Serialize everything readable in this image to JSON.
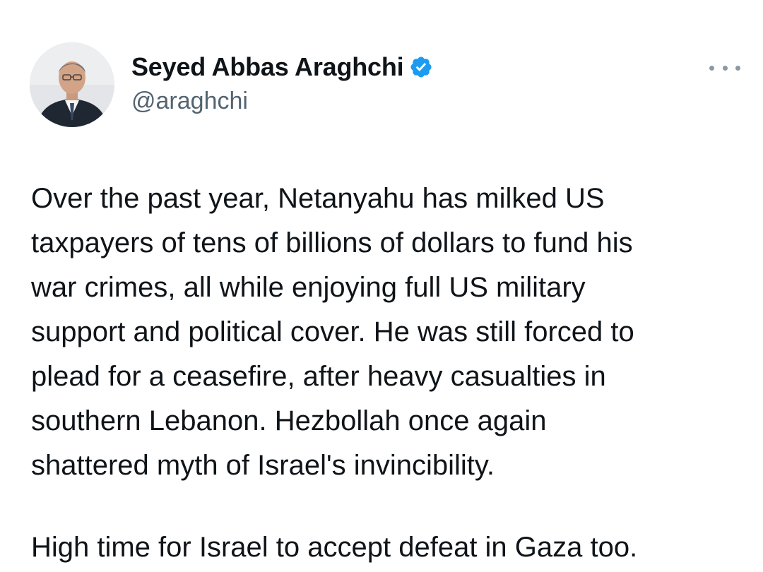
{
  "author": {
    "display_name": "Seyed Abbas Araghchi",
    "handle": "@araghchi",
    "verified": true,
    "verified_color": "#1d9bf0"
  },
  "tweet": {
    "paragraph_1_lines": [
      "Over the past year, Netanyahu has milked US",
      "taxpayers of tens of billions of dollars to fund his",
      "war crimes, all while enjoying full US military",
      "support and political cover. He was still forced to",
      "plead for a ceasefire, after heavy casualties in",
      "southern Lebanon. Hezbollah once again",
      "shattered myth of Israel's invincibility."
    ],
    "paragraph_2": "High time for Israel to accept defeat in Gaza too."
  },
  "icons": {
    "avatar": "profile-photo",
    "verified": "verified-badge-icon",
    "more": "more-options-icon"
  },
  "colors": {
    "text": "#0f1419",
    "secondary_text": "#536471",
    "accent": "#1d9bf0"
  }
}
